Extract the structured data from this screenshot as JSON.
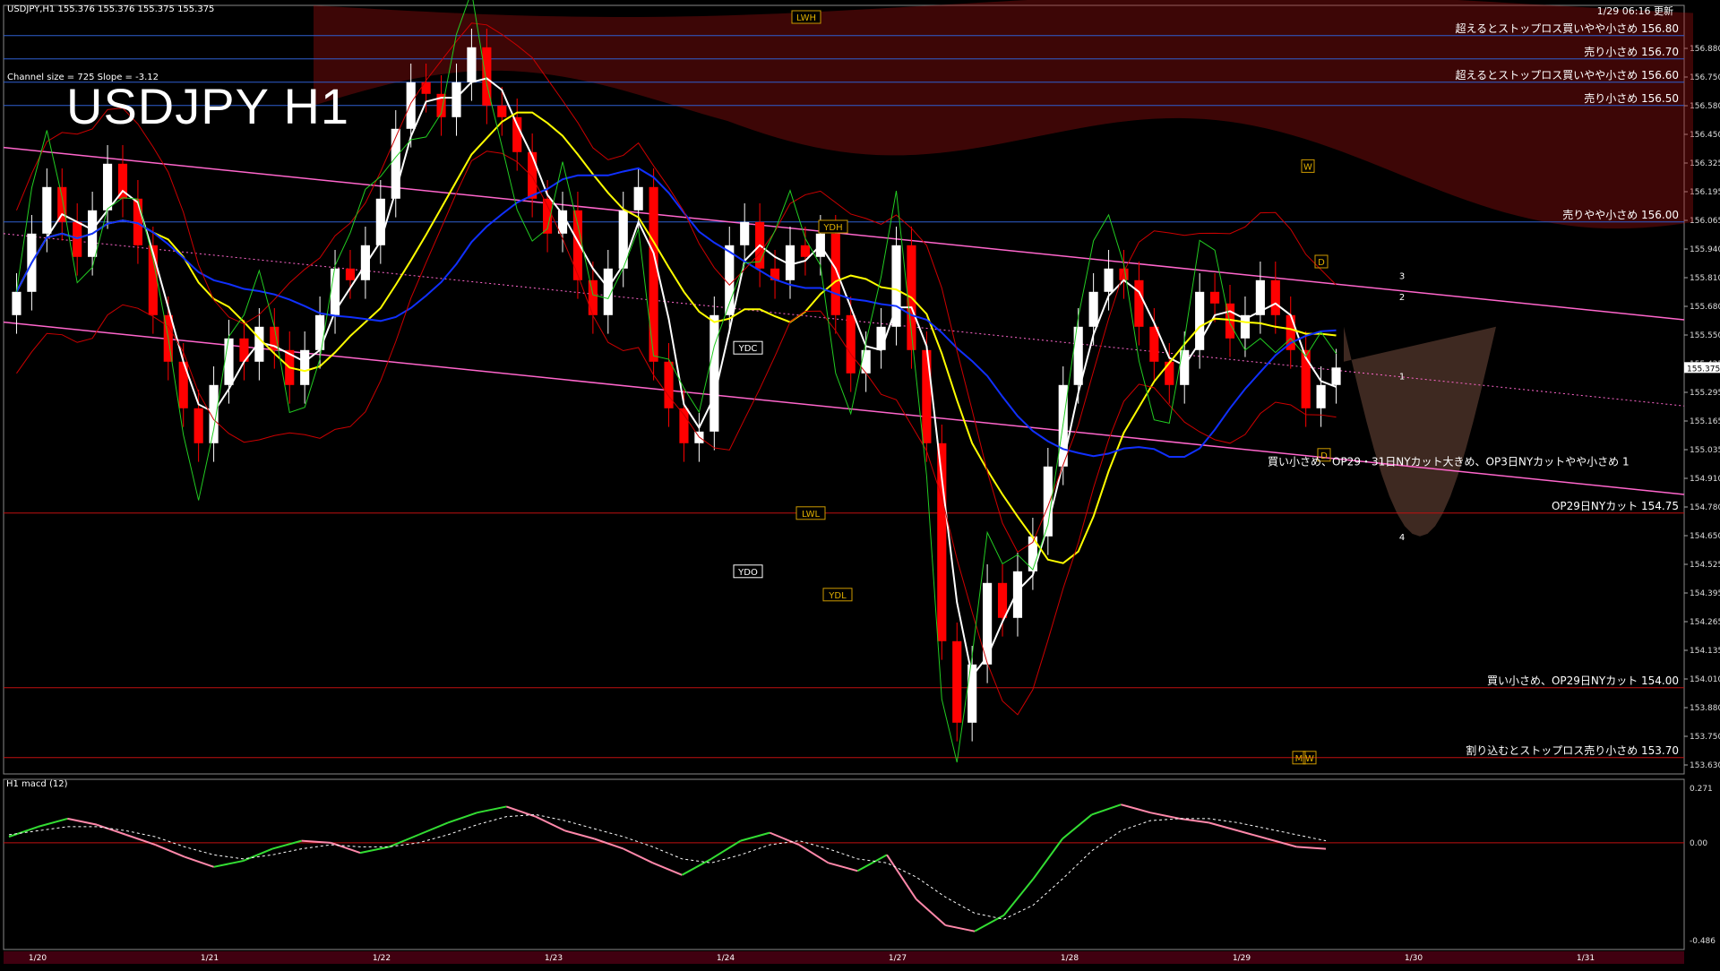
{
  "header": {
    "symbol_info": "USDJPY,H1  155.376 155.376 155.375 155.375",
    "channel_info": "Channel size = 725 Slope = -3.12",
    "big_title": "USDJPY H1",
    "updated": "1/29 06:16 更新"
  },
  "subwindow": {
    "label": "H1  macd (12)"
  },
  "colors": {
    "background": "#000000",
    "bull_candle": "#ffffff",
    "bear_candle": "#ff0000",
    "level_blue": "#2f5fd0",
    "level_red": "#c01010",
    "cloud_red": "#b01010",
    "channel_pink": "#ff66cc",
    "ma_white": "#ffffff",
    "ma_yellow": "#ffff00",
    "ma_blue": "#1030ff",
    "band_red": "#cc0000",
    "green_line": "#22cc22",
    "macd_green": "#33dd33",
    "macd_pink": "#ff88aa"
  },
  "chart_data": {
    "type": "candlestick",
    "symbol": "USDJPY",
    "timeframe": "H1",
    "ylim": [
      153.63,
      156.93
    ],
    "y_ticks": [
      "156.880",
      "156.750",
      "156.580",
      "156.450",
      "156.325",
      "156.195",
      "156.065",
      "155.940",
      "155.810",
      "155.680",
      "155.550",
      "155.425",
      "155.295",
      "155.165",
      "155.035",
      "154.910",
      "154.780",
      "154.650",
      "154.525",
      "154.395",
      "154.265",
      "154.135",
      "154.010",
      "153.880",
      "153.750",
      "153.630"
    ],
    "current_price": "155.375",
    "x_ticks": [
      "1/20",
      "1/21",
      "1/22",
      "1/23",
      "1/24",
      "1/27",
      "1/28",
      "1/29",
      "1/30",
      "1/31"
    ],
    "levels": [
      {
        "price": 156.8,
        "label": "超えるとストップロス買いやや小さめ 156.80",
        "color": "#2f5fd0"
      },
      {
        "price": 156.7,
        "label": "売り小さめ 156.70",
        "color": "#2f5fd0"
      },
      {
        "price": 156.6,
        "label": "超えるとストップロス買いやや小さめ 156.60",
        "color": "#2f5fd0"
      },
      {
        "price": 156.5,
        "label": "売り小さめ 156.50",
        "color": "#2f5fd0"
      },
      {
        "price": 156.0,
        "label": "売りやや小さめ 156.00",
        "color": "#2f5fd0"
      },
      {
        "price": 154.75,
        "label": "OP29日NYカット 154.75",
        "color": "#c01010"
      },
      {
        "price": 154.0,
        "label": "買い小さめ、OP29日NYカット 154.00",
        "color": "#c01010"
      },
      {
        "price": 153.7,
        "label": "割り込むとストップロス売り小さめ 153.70",
        "color": "#c01010"
      }
    ],
    "annotation": "買い小さめ、OP29・31日NYカット大きめ、OP3日NYカットやや小さめ 1",
    "tags": [
      "LWH",
      "YDH",
      "YDC",
      "LWL",
      "YDO",
      "YDL"
    ],
    "markers": [
      "W",
      "D",
      "M",
      "W",
      "D",
      "1",
      "2",
      "3",
      "4"
    ],
    "closes": [
      155.7,
      155.95,
      156.15,
      156.0,
      155.85,
      156.05,
      156.25,
      156.1,
      155.9,
      155.6,
      155.4,
      155.2,
      155.05,
      155.3,
      155.5,
      155.4,
      155.55,
      155.45,
      155.3,
      155.45,
      155.6,
      155.8,
      155.75,
      155.9,
      156.1,
      156.4,
      156.6,
      156.55,
      156.45,
      156.6,
      156.75,
      156.5,
      156.45,
      156.3,
      156.1,
      155.95,
      156.05,
      155.75,
      155.6,
      155.8,
      156.05,
      156.15,
      155.4,
      155.2,
      155.05,
      155.1,
      155.6,
      155.9,
      156.0,
      155.8,
      155.75,
      155.9,
      155.85,
      155.95,
      155.6,
      155.35,
      155.45,
      155.55,
      155.9,
      155.45,
      155.05,
      154.2,
      153.85,
      154.1,
      154.45,
      154.3,
      154.5,
      154.65,
      154.95,
      155.3,
      155.55,
      155.7,
      155.8,
      155.75,
      155.55,
      155.4,
      155.3,
      155.45,
      155.7,
      155.65,
      155.5,
      155.6,
      155.75,
      155.6,
      155.45,
      155.2,
      155.3,
      155.375
    ],
    "macd_range": [
      "0.271",
      "0.00",
      "-0.486"
    ],
    "macd_values": [
      0.03,
      0.08,
      0.12,
      0.09,
      0.04,
      -0.01,
      -0.07,
      -0.12,
      -0.09,
      -0.03,
      0.01,
      0.0,
      -0.05,
      -0.02,
      0.04,
      0.1,
      0.15,
      0.18,
      0.13,
      0.06,
      0.02,
      -0.03,
      -0.1,
      -0.16,
      -0.08,
      0.01,
      0.05,
      -0.01,
      -0.1,
      -0.14,
      -0.06,
      -0.28,
      -0.41,
      -0.44,
      -0.36,
      -0.18,
      0.02,
      0.14,
      0.19,
      0.15,
      0.12,
      0.1,
      0.06,
      0.02,
      -0.02,
      -0.03
    ],
    "macd_signal": [
      0.04,
      0.06,
      0.08,
      0.08,
      0.06,
      0.03,
      -0.02,
      -0.06,
      -0.08,
      -0.06,
      -0.03,
      -0.01,
      -0.02,
      -0.02,
      0.0,
      0.04,
      0.09,
      0.13,
      0.14,
      0.11,
      0.07,
      0.03,
      -0.02,
      -0.08,
      -0.1,
      -0.06,
      -0.01,
      0.01,
      -0.03,
      -0.08,
      -0.1,
      -0.17,
      -0.27,
      -0.35,
      -0.38,
      -0.31,
      -0.18,
      -0.04,
      0.06,
      0.11,
      0.12,
      0.12,
      0.1,
      0.07,
      0.04,
      0.01
    ]
  }
}
